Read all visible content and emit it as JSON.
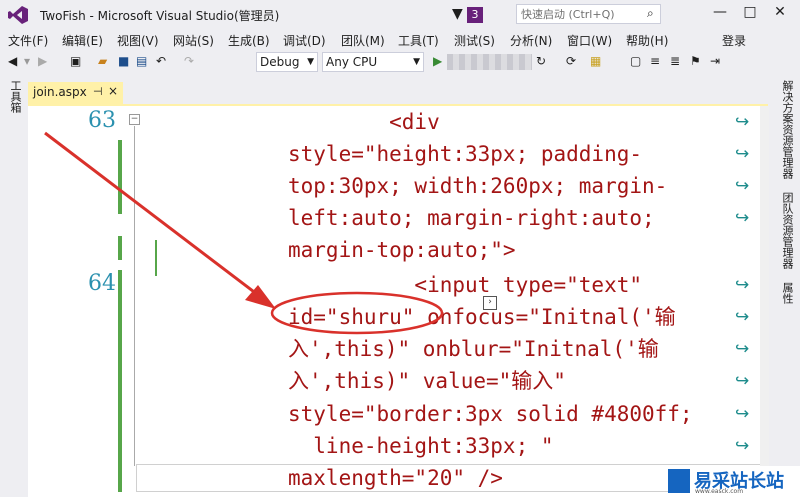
{
  "window": {
    "title": "TwoFish - Microsoft Visual Studio(管理员)",
    "notif_count": "3",
    "quick_launch_placeholder": "快速启动 (Ctrl+Q)"
  },
  "menu": [
    "文件(F)",
    "编辑(E)",
    "视图(V)",
    "网站(S)",
    "生成(B)",
    "调试(D)",
    "团队(M)",
    "工具(T)",
    "测试(S)",
    "分析(N)",
    "窗口(W)",
    "帮助(H)"
  ],
  "login": "登录",
  "toolbar": {
    "config": "Debug",
    "platform": "Any CPU"
  },
  "left_tab": "工具箱",
  "right_tabs": [
    "解决方案资源管理器",
    "团队资源管理器",
    "属性"
  ],
  "doc_tab": {
    "label": "join.aspx"
  },
  "editor": {
    "line_numbers": [
      "63",
      "64"
    ],
    "lines": [
      "        <div",
      "style=\"height:33px; padding-",
      "top:30px; width:260px; margin-",
      "left:auto; margin-right:auto;",
      "margin-top:auto;\">",
      "          <input type=\"text\"",
      "id=\"shuru\" onfocus=\"Initnal('输",
      "入',this)\" onblur=\"Initnal('输",
      "入',this)\" value=\"输入\"",
      "style=\"border:3px solid #4800ff;",
      "  line-height:33px; \"",
      "maxlength=\"20\" />"
    ]
  },
  "annotation": {
    "color": "#d9312b"
  },
  "watermark": {
    "text": "易采站长站",
    "url": "www.easck.com"
  },
  "colors": {
    "vs_purple": "#68217a",
    "doc_tab": "#fff1a8",
    "line_number": "#2b91af",
    "change_bar": "#57a64a"
  }
}
